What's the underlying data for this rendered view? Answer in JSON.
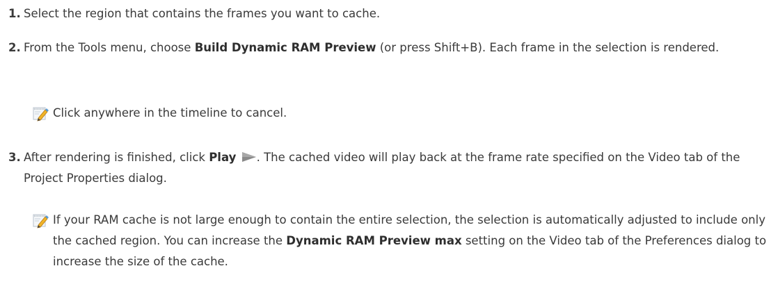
{
  "steps": [
    {
      "number": "1.",
      "text": "Select the region that contains the frames you want to cache."
    },
    {
      "number": "2.",
      "text_before": "From the Tools menu, choose ",
      "bold": "Build Dynamic RAM Preview",
      "text_after": " (or press Shift+B). Each frame in the selection is rendered.",
      "note": "Click anywhere in the timeline to cancel."
    },
    {
      "number": "3.",
      "text_before": "After rendering is finished, click ",
      "bold": "Play",
      "text_after": ". The cached video will play back at the frame rate specified on the Video tab of the Project Properties dialog.",
      "note_before": "If your RAM cache is not large enough to contain the entire selection, the selection is automatically adjusted to include only the cached region. You can increase the ",
      "note_bold": "Dynamic RAM Preview max",
      "note_after": " setting on the Video tab of the Preferences dialog to increase the size of the cache."
    }
  ],
  "icons": {
    "note": "note-pencil-icon",
    "play": "play-icon"
  },
  "colors": {
    "text": "#3a3a3a",
    "play_icon": "#8a8a8a",
    "pencil": "#e8a020"
  }
}
